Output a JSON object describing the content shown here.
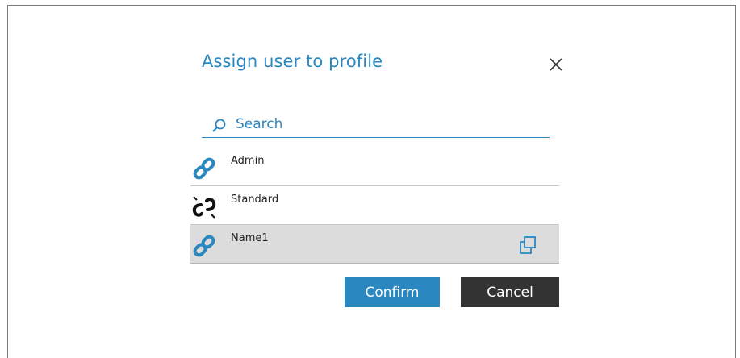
{
  "dialog": {
    "title": "Assign user to profile",
    "close_icon": "close-icon"
  },
  "search": {
    "placeholder": "Search",
    "value": "",
    "icon": "search-icon"
  },
  "profiles": [
    {
      "label": "Admin",
      "icon": "link-icon",
      "linked": true,
      "selected": false
    },
    {
      "label": "Standard",
      "icon": "broken-link-icon",
      "linked": false,
      "selected": false
    },
    {
      "label": "Name1",
      "icon": "link-icon",
      "linked": true,
      "selected": true,
      "action_icon": "copy-icon"
    }
  ],
  "buttons": {
    "confirm_label": "Confirm",
    "cancel_label": "Cancel"
  },
  "colors": {
    "accent": "#2b87c0",
    "dark": "#333333",
    "selected_row": "#dcdcdc"
  }
}
